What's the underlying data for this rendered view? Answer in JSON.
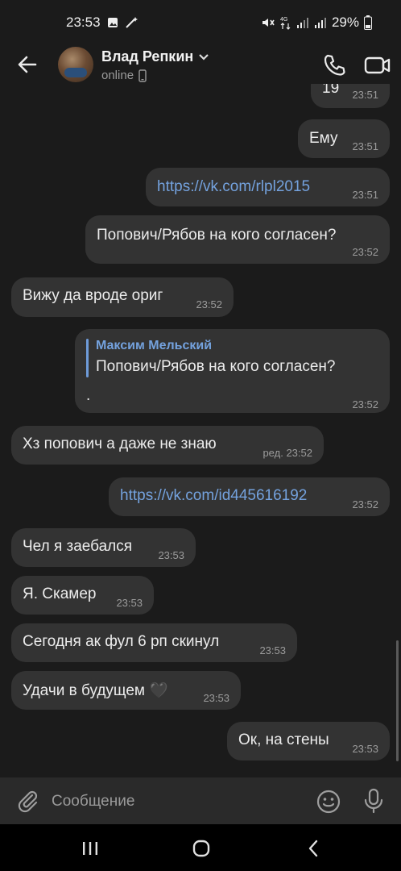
{
  "status_bar": {
    "time": "23:53",
    "network": "4G",
    "battery": "29%"
  },
  "header": {
    "contact_name": "Влад Репкин",
    "contact_status": "online"
  },
  "messages": [
    {
      "text": "19",
      "time": "23:51",
      "outgoing": true
    },
    {
      "text": "Ему",
      "time": "23:51",
      "outgoing": true
    },
    {
      "text": "https://vk.com/rlpl2015",
      "time": "23:51",
      "outgoing": true,
      "link": true
    },
    {
      "text": "Попович/Рябов на кого согласен?",
      "time": "23:52",
      "outgoing": true
    },
    {
      "text": "Вижу да вроде ориг",
      "time": "23:52",
      "outgoing": false
    },
    {
      "reply_author": "Максим Мельский",
      "reply_text": "Попович/Рябов на кого согласен?",
      "text": ".",
      "time": "23:52",
      "outgoing": true
    },
    {
      "text": "Хз попович а даже не знаю",
      "time": "23:52",
      "edited_label": "ред.",
      "outgoing": false
    },
    {
      "text": "https://vk.com/id445616192",
      "time": "23:52",
      "outgoing": true,
      "link": true
    },
    {
      "text": "Чел я заебался",
      "time": "23:53",
      "outgoing": false
    },
    {
      "text": "Я. Скамер",
      "time": "23:53",
      "outgoing": false
    },
    {
      "text": "Сегодня ак фул 6 рп скинул",
      "time": "23:53",
      "outgoing": false
    },
    {
      "text": "Удачи в будущем 🖤",
      "time": "23:53",
      "outgoing": false
    },
    {
      "text": "Ок, на стены",
      "time": "23:53",
      "outgoing": true
    }
  ],
  "composer": {
    "placeholder": "Сообщение"
  },
  "icons": {
    "back": "arrow-left-icon",
    "call": "phone-icon",
    "video": "video-camera-icon",
    "attach": "paperclip-icon",
    "emoji": "smile-icon",
    "mic": "microphone-icon"
  }
}
